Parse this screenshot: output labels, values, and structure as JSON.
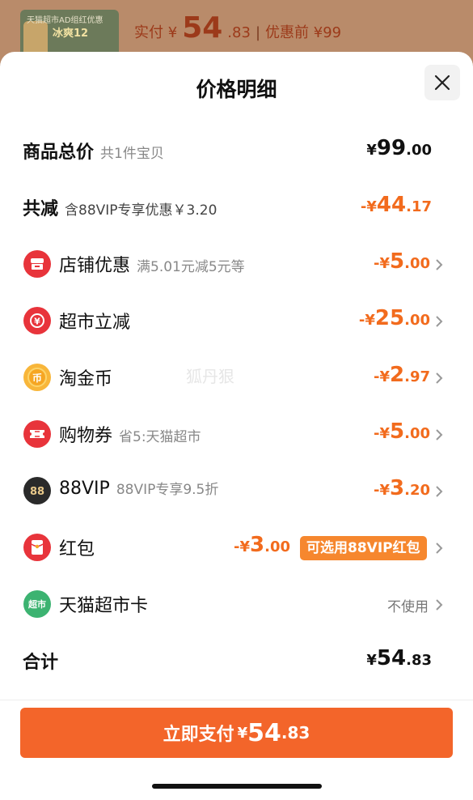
{
  "background": {
    "thumb_top_text": "天猫超市AD组红优惠",
    "thumb_text": "冰爽12",
    "paid_label": "实付 ¥",
    "paid_int": "54",
    "paid_dec": ".83",
    "original_label": "优惠前 ¥99"
  },
  "sheet": {
    "title": "价格明细",
    "close_icon": "close-icon"
  },
  "rows": {
    "total": {
      "label": "商品总价",
      "sub": "共1件宝贝",
      "cur": "¥",
      "int": "99",
      "dec": ".00"
    },
    "reduce": {
      "label": "共减",
      "sub": "含88VIP专享优惠￥3.20",
      "cur": "-¥",
      "int": "44",
      "dec": ".17"
    },
    "store": {
      "label": "店铺优惠",
      "sub": "满5.01元减5元等",
      "cur": "-¥",
      "int": "5",
      "dec": ".00",
      "icon": "store-icon"
    },
    "market": {
      "label": "超市立减",
      "sub": "",
      "cur": "-¥",
      "int": "25",
      "dec": ".00",
      "icon": "discount-icon"
    },
    "coin": {
      "label": "淘金币",
      "sub": "",
      "cur": "-¥",
      "int": "2",
      "dec": ".97",
      "icon": "coin-icon"
    },
    "coupon": {
      "label": "购物券",
      "sub": "省5:天猫超市",
      "cur": "-¥",
      "int": "5",
      "dec": ".00",
      "icon": "coupon-icon"
    },
    "vip": {
      "label": "88VIP",
      "sub": "88VIP专享9.5折",
      "cur": "-¥",
      "int": "3",
      "dec": ".20",
      "icon": "vip-icon"
    },
    "redpacket": {
      "label": "红包",
      "cur": "-¥",
      "int": "3",
      "dec": ".00",
      "tag": "可选用88VIP红包",
      "icon": "red-packet-icon"
    },
    "card": {
      "label": "天猫超市卡",
      "status": "不使用",
      "icon": "supermarket-card-icon",
      "icon_text": "超市"
    },
    "sum": {
      "label": "合计",
      "cur": "¥",
      "int": "54",
      "dec": ".83"
    }
  },
  "watermark": "狐丹狠",
  "pay": {
    "label": "立即支付",
    "cur": "¥",
    "int": "54",
    "dec": ".83"
  },
  "colors": {
    "accent": "#f3652a",
    "orange_text": "#f26b1d",
    "red_icon": "#e8343b"
  }
}
